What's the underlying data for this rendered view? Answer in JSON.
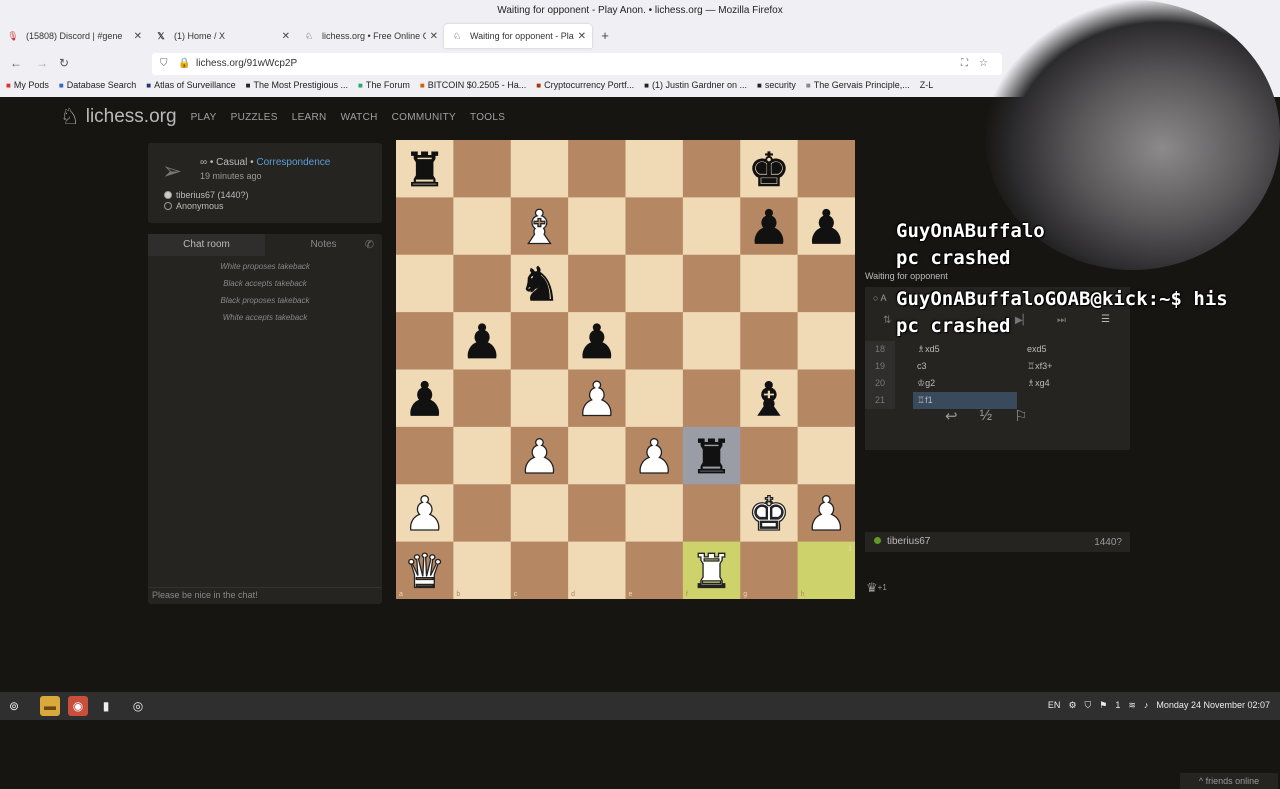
{
  "browser": {
    "window_title": "Waiting for opponent - Play Anon. • lichess.org — Mozilla Firefox",
    "tabs": [
      {
        "icon": "microphone-icon",
        "label": "(15808) Discord | #gene"
      },
      {
        "icon": "x-logo-icon",
        "label": "(1) Home / X"
      },
      {
        "icon": "lichess-logo-icon",
        "label": "lichess.org • Free Online Ch"
      },
      {
        "icon": "lichess-logo-icon",
        "label": "Waiting for opponent - Play"
      }
    ],
    "url": "lichess.org/91wWcp2P",
    "bookmarks": [
      "My Pods",
      "Database Search",
      "Atlas of Surveillance",
      "The Most Prestigious ...",
      "The Forum",
      "BITCOIN $0.2505 - Ha...",
      "Cryptocurrency Portf...",
      "(1) Justin Gardner on ...",
      "security",
      "The Gervais Principle,...",
      "Z-L"
    ]
  },
  "site": {
    "logo": "lichess.org",
    "nav": [
      "PLAY",
      "PUZZLES",
      "LEARN",
      "WATCH",
      "COMMUNITY",
      "TOOLS"
    ]
  },
  "game": {
    "meta_prefix": "∞ • Casual •",
    "meta_link": "Correspondence",
    "time_ago": "19 minutes ago",
    "white": "tiberius67 (1440?)",
    "black": "Anonymous"
  },
  "chat": {
    "tab_chat": "Chat room",
    "tab_notes": "Notes",
    "messages": [
      "White proposes takeback",
      "Black accepts takeback",
      "Black proposes takeback",
      "White accepts takeback"
    ],
    "placeholder": "Please be nice in the chat!"
  },
  "board": {
    "files": [
      "a",
      "b",
      "c",
      "d",
      "e",
      "f",
      "g",
      "h"
    ],
    "ranks": [
      "8",
      "7",
      "6",
      "5",
      "4",
      "3",
      "2",
      "1"
    ],
    "pieces": [
      {
        "sq": "a8",
        "glyph": "♜",
        "color": "b"
      },
      {
        "sq": "g8",
        "glyph": "♚",
        "color": "b"
      },
      {
        "sq": "c7",
        "glyph": "♝",
        "color": "w"
      },
      {
        "sq": "g7",
        "glyph": "♟",
        "color": "b"
      },
      {
        "sq": "h7",
        "glyph": "♟",
        "color": "b"
      },
      {
        "sq": "c6",
        "glyph": "♞",
        "color": "b"
      },
      {
        "sq": "b5",
        "glyph": "♟",
        "color": "b"
      },
      {
        "sq": "d5",
        "glyph": "♟",
        "color": "b"
      },
      {
        "sq": "a4",
        "glyph": "♟",
        "color": "b"
      },
      {
        "sq": "d4",
        "glyph": "♟",
        "color": "w"
      },
      {
        "sq": "g4",
        "glyph": "♝",
        "color": "b"
      },
      {
        "sq": "c3",
        "glyph": "♟",
        "color": "w"
      },
      {
        "sq": "e3",
        "glyph": "♟",
        "color": "w"
      },
      {
        "sq": "f3",
        "glyph": "♜",
        "color": "b"
      },
      {
        "sq": "a2",
        "glyph": "♟",
        "color": "w"
      },
      {
        "sq": "g2",
        "glyph": "♚",
        "color": "w"
      },
      {
        "sq": "h2",
        "glyph": "♟",
        "color": "w"
      },
      {
        "sq": "a1",
        "glyph": "♛",
        "color": "w"
      },
      {
        "sq": "f1",
        "glyph": "♜",
        "color": "w"
      }
    ],
    "last_move": [
      "f1",
      "h1"
    ],
    "check": "f3",
    "colors": {
      "light": "#f0d9b5",
      "dark": "#b58863",
      "last_move": "#cdd26a",
      "check": "#9a9ca6"
    }
  },
  "panel": {
    "status": "Waiting for opponent",
    "anon_label": "A",
    "moves": [
      {
        "num": "18",
        "white": "♗xd5",
        "black": "exd5"
      },
      {
        "num": "19",
        "white": "c3",
        "black": "♖xf3+"
      },
      {
        "num": "20",
        "white": "♔g2",
        "black": "♗xg4"
      },
      {
        "num": "21",
        "white": "♖f1",
        "black": ""
      }
    ],
    "actions": [
      "↩",
      "½",
      "⚐"
    ],
    "opponent": "tiberius67",
    "opponent_rating": "1440?",
    "captured": "♛",
    "captured_count": "+1"
  },
  "overlay": {
    "line1": "GuyOnABuffalo",
    "line2": "pc crashed",
    "line3": "GuyOnABuffaloGOAB@kick:~$ his",
    "line4": "pc crashed"
  },
  "footer": {
    "friends": "friends online"
  },
  "taskbar": {
    "lang": "EN",
    "clock": "Monday 24 November 02:07",
    "tray_count": "1"
  }
}
